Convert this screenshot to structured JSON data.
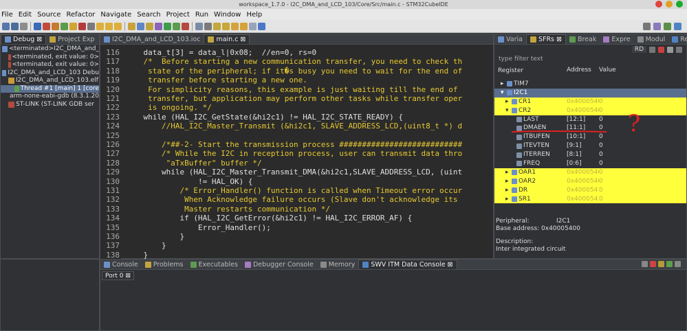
{
  "window": {
    "title": "workspace_1.7.0 - I2C_DMA_and_LCD_103/Core/Src/main.c - STM32CubeIDE"
  },
  "menu": [
    "File",
    "Edit",
    "Source",
    "Refactor",
    "Navigate",
    "Search",
    "Project",
    "Run",
    "Window",
    "Help"
  ],
  "debug_view": {
    "tabs": [
      {
        "label": "Debug",
        "close": "⊠"
      },
      {
        "label": "Project Exp"
      }
    ],
    "tree": [
      {
        "indent": 0,
        "icon": "launch-icon",
        "label": "<terminated>I2C_DMA_and_"
      },
      {
        "indent": 1,
        "icon": "process-icon",
        "label": "<terminated, exit value: 0>"
      },
      {
        "indent": 1,
        "icon": "process-icon",
        "label": "<terminated, exit value: 0>"
      },
      {
        "indent": 0,
        "icon": "launch-icon",
        "label": "I2C_DMA_and_LCD_103 Debu"
      },
      {
        "indent": 1,
        "icon": "elf-icon",
        "label": "I2C_DMA_and_LCD_103.elf"
      },
      {
        "indent": 2,
        "icon": "thread-icon",
        "label": "Thread #1 [main] 1 [core"
      },
      {
        "indent": 1,
        "icon": "process-icon",
        "label": "arm-none-eabi-gdb (8.3.1.20"
      },
      {
        "indent": 1,
        "icon": "process-icon",
        "label": "ST-LINK (ST-LINK GDB ser"
      }
    ]
  },
  "editor": {
    "tabs": [
      {
        "label": "I2C_DMA_and_LCD_103.ioc"
      },
      {
        "label": "main.c",
        "close": "⊠"
      }
    ],
    "lines": [
      {
        "n": "116",
        "t": "    data_t[3] = data_l|0x08;  //en=0, rs=0",
        "c": false
      },
      {
        "n": "117",
        "t": "    /*  Before starting a new communication transfer, you need to check th",
        "c": true
      },
      {
        "n": "118",
        "t": "     state of the peripheral; if it�s busy you need to wait for the end of",
        "c": true
      },
      {
        "n": "119",
        "t": "     transfer before starting a new one.",
        "c": true
      },
      {
        "n": "120",
        "t": "     For simplicity reasons, this example is just waiting till the end of",
        "c": true
      },
      {
        "n": "121",
        "t": "     transfer, but application may perform other tasks while transfer oper",
        "c": true
      },
      {
        "n": "122",
        "t": "     is ongoing. */",
        "c": true
      },
      {
        "n": "123",
        "t": "    while (HAL_I2C_GetState(&hi2c1) != HAL_I2C_STATE_READY) {",
        "c": false
      },
      {
        "n": "124",
        "t": "        //HAL_I2C_Master_Transmit (&hi2c1, SLAVE_ADDRESS_LCD,(uint8_t *) d",
        "c": true
      },
      {
        "n": "125",
        "t": "",
        "c": false
      },
      {
        "n": "126",
        "t": "        /*##-2- Start the transmission process ###########################",
        "c": true
      },
      {
        "n": "127",
        "t": "        /* While the I2C in reception process, user can transmit data thro",
        "c": true
      },
      {
        "n": "128",
        "t": "         \"aTxBuffer\" buffer */",
        "c": true
      },
      {
        "n": "129",
        "t": "        while (HAL_I2C_Master_Transmit_DMA(&hi2c1,SLAVE_ADDRESS_LCD, (uint",
        "c": false
      },
      {
        "n": "130",
        "t": "                != HAL_OK) {",
        "c": false
      },
      {
        "n": "131",
        "t": "            /* Error_Handler() function is called when Timeout error occur",
        "c": true
      },
      {
        "n": "132",
        "t": "             When Acknowledge failure occurs (Slave don't acknowledge its",
        "c": true
      },
      {
        "n": "133",
        "t": "             Master restarts communication */",
        "c": true
      },
      {
        "n": "134",
        "t": "            if (HAL_I2C_GetError(&hi2c1) != HAL_I2C_ERROR_AF) {",
        "c": false
      },
      {
        "n": "135",
        "t": "                Error_Handler();",
        "c": false
      },
      {
        "n": "136",
        "t": "            }",
        "c": false
      },
      {
        "n": "137",
        "t": "        }",
        "c": false
      },
      {
        "n": "138",
        "t": "    }",
        "c": false
      }
    ]
  },
  "sfr_view": {
    "tabs": [
      {
        "label": "Varia"
      },
      {
        "label": "SFRs",
        "close": "⊠"
      },
      {
        "label": "Break"
      },
      {
        "label": "Expre"
      },
      {
        "label": "Modul"
      },
      {
        "label": "Regis"
      }
    ],
    "rd_label": "RD",
    "filter_placeholder": "type filter text",
    "columns": {
      "register": "Register",
      "address": "Address",
      "value": "Value"
    },
    "rows": [
      {
        "indent": 1,
        "expander": "▸",
        "name": "TIM7",
        "address": "",
        "value": "",
        "hl": false,
        "sel": false
      },
      {
        "indent": 1,
        "expander": "▾",
        "name": "I2C1",
        "address": "",
        "value": "",
        "hl": false,
        "sel": true
      },
      {
        "indent": 2,
        "expander": "▸",
        "name": "CR1",
        "address": "0x4000540",
        "value": "0",
        "hl": true,
        "sel": false
      },
      {
        "indent": 2,
        "expander": "▾",
        "name": "CR2",
        "address": "0x4000540",
        "value": "0",
        "hl": true,
        "sel": false
      },
      {
        "indent": 3,
        "expander": "",
        "name": "LAST",
        "address": "[12:1]",
        "value": "0",
        "hl": false,
        "sel": false
      },
      {
        "indent": 3,
        "expander": "",
        "name": "DMAEN",
        "address": "[11:1]",
        "value": "0",
        "hl": false,
        "sel": false
      },
      {
        "indent": 3,
        "expander": "",
        "name": "ITBUFEN",
        "address": "[10:1]",
        "value": "0",
        "hl": false,
        "sel": false
      },
      {
        "indent": 3,
        "expander": "",
        "name": "ITEVTEN",
        "address": "[9:1]",
        "value": "0",
        "hl": false,
        "sel": false
      },
      {
        "indent": 3,
        "expander": "",
        "name": "ITERREN",
        "address": "[8:1]",
        "value": "0",
        "hl": false,
        "sel": false
      },
      {
        "indent": 3,
        "expander": "",
        "name": "FREQ",
        "address": "[0:6]",
        "value": "0",
        "hl": false,
        "sel": false
      },
      {
        "indent": 2,
        "expander": "▸",
        "name": "OAR1",
        "address": "0x4000540",
        "value": "0",
        "hl": true,
        "sel": false
      },
      {
        "indent": 2,
        "expander": "▸",
        "name": "OAR2",
        "address": "0x4000540",
        "value": "0",
        "hl": true,
        "sel": false
      },
      {
        "indent": 2,
        "expander": "▸",
        "name": "DR",
        "address": "0x4000541",
        "value": "0",
        "hl": true,
        "sel": false
      },
      {
        "indent": 2,
        "expander": "▸",
        "name": "SR1",
        "address": "0x4000541",
        "value": "0",
        "hl": true,
        "sel": false
      }
    ],
    "details": {
      "peripheral_label": "Peripheral:",
      "peripheral_value": "I2C1",
      "base_address": "Base address: 0x40005400",
      "description_label": "Description:",
      "description": "Inter integrated circuit"
    },
    "annotation_text": "?"
  },
  "console_view": {
    "tabs": [
      {
        "label": "Console"
      },
      {
        "label": "Problems"
      },
      {
        "label": "Executables"
      },
      {
        "label": "Debugger Console"
      },
      {
        "label": "Memory"
      },
      {
        "label": "SWV ITM Data Console",
        "close": "⊠"
      }
    ],
    "port_tab": "Port 0",
    "port_close": "⊠"
  },
  "colors": {
    "highlight": "#ffff3c",
    "annotation": "#e02020",
    "comment": "#e6c832",
    "selection": "#5a6e8f"
  }
}
